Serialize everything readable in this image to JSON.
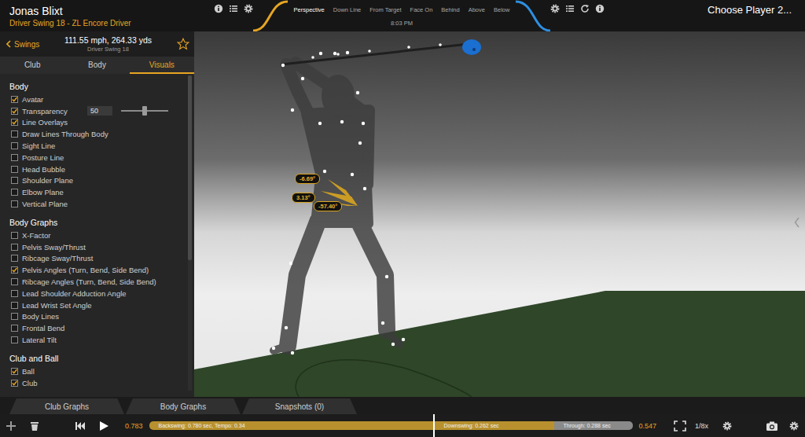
{
  "header": {
    "player": "Jonas Blixt",
    "swing": "Driver Swing 18 - ZL Encore Driver",
    "clock": "8:03 PM",
    "player_two": "Choose Player 2...",
    "views": [
      {
        "label": "Perspective",
        "selected": true
      },
      {
        "label": "Down Line",
        "selected": false
      },
      {
        "label": "From Target",
        "selected": false
      },
      {
        "label": "Face On",
        "selected": false
      },
      {
        "label": "Behind",
        "selected": false
      },
      {
        "label": "Above",
        "selected": false
      },
      {
        "label": "Below",
        "selected": false
      }
    ]
  },
  "swing_panel": {
    "back": "Swings",
    "stats": "111.55 mph, 264.33 yds",
    "name": "Driver Swing 18",
    "favorite": false
  },
  "panel_tabs": [
    {
      "label": "Club",
      "selected": false
    },
    {
      "label": "Body",
      "selected": false
    },
    {
      "label": "Visuals",
      "selected": true
    }
  ],
  "sections": [
    {
      "title": "Body",
      "items": [
        {
          "label": "Avatar",
          "kind": "checkbox",
          "checked": true
        },
        {
          "label": "Transparency",
          "kind": "slider",
          "checked": true,
          "value": "50",
          "level": 0.5
        },
        {
          "label": "Line Overlays",
          "kind": "checkbox",
          "checked": true
        },
        {
          "label": "Draw Lines Through Body",
          "kind": "checkbox",
          "checked": false
        },
        {
          "label": "Sight Line",
          "kind": "checkbox",
          "checked": false
        },
        {
          "label": "Posture Line",
          "kind": "checkbox",
          "checked": false
        },
        {
          "label": "Head Bubble",
          "kind": "checkbox",
          "checked": false
        },
        {
          "label": "Shoulder Plane",
          "kind": "checkbox",
          "checked": false
        },
        {
          "label": "Elbow Plane",
          "kind": "checkbox",
          "checked": false
        },
        {
          "label": "Vertical Plane",
          "kind": "checkbox",
          "checked": false
        }
      ]
    },
    {
      "title": "Body Graphs",
      "items": [
        {
          "label": "X-Factor",
          "kind": "checkbox",
          "checked": false
        },
        {
          "label": "Pelvis Sway/Thrust",
          "kind": "checkbox",
          "checked": false
        },
        {
          "label": "Ribcage Sway/Thrust",
          "kind": "checkbox",
          "checked": false
        },
        {
          "label": "Pelvis Angles (Turn, Bend, Side Bend)",
          "kind": "checkbox",
          "checked": true
        },
        {
          "label": "Ribcage Angles (Turn, Bend, Side Bend)",
          "kind": "checkbox",
          "checked": false
        },
        {
          "label": "Lead Shoulder Adduction Angle",
          "kind": "checkbox",
          "checked": false
        },
        {
          "label": "Lead Wrist Set Angle",
          "kind": "checkbox",
          "checked": false
        },
        {
          "label": "Body Lines",
          "kind": "checkbox",
          "checked": false
        },
        {
          "label": "Frontal Bend",
          "kind": "checkbox",
          "checked": false
        },
        {
          "label": "Lateral Tilt",
          "kind": "checkbox",
          "checked": false
        }
      ]
    },
    {
      "title": "Club and Ball",
      "items": [
        {
          "label": "Ball",
          "kind": "checkbox",
          "checked": true
        },
        {
          "label": "Club",
          "kind": "checkbox",
          "checked": true
        }
      ]
    }
  ],
  "angles": [
    "-6.69°",
    "3.13°",
    "-57.40°"
  ],
  "bottom_tabs": [
    {
      "label": "Club Graphs",
      "selected": false
    },
    {
      "label": "Body Graphs",
      "selected": false
    },
    {
      "label": "Snapshots (0)",
      "selected": false
    }
  ],
  "playback": {
    "start": "0.783",
    "end": "0.547",
    "speed": "1/8x",
    "level": 0.59,
    "segments": [
      {
        "label": "Backswing: 0.780 sec, Tempo: 0.34",
        "kind": "backswing",
        "color": "#b8912e"
      },
      {
        "label": "Downswing: 0.262 sec",
        "kind": "downswing",
        "color": "#b8912e"
      },
      {
        "label": "Through: 0.288 sec",
        "kind": "through",
        "color": "#8a8a8a"
      }
    ]
  }
}
